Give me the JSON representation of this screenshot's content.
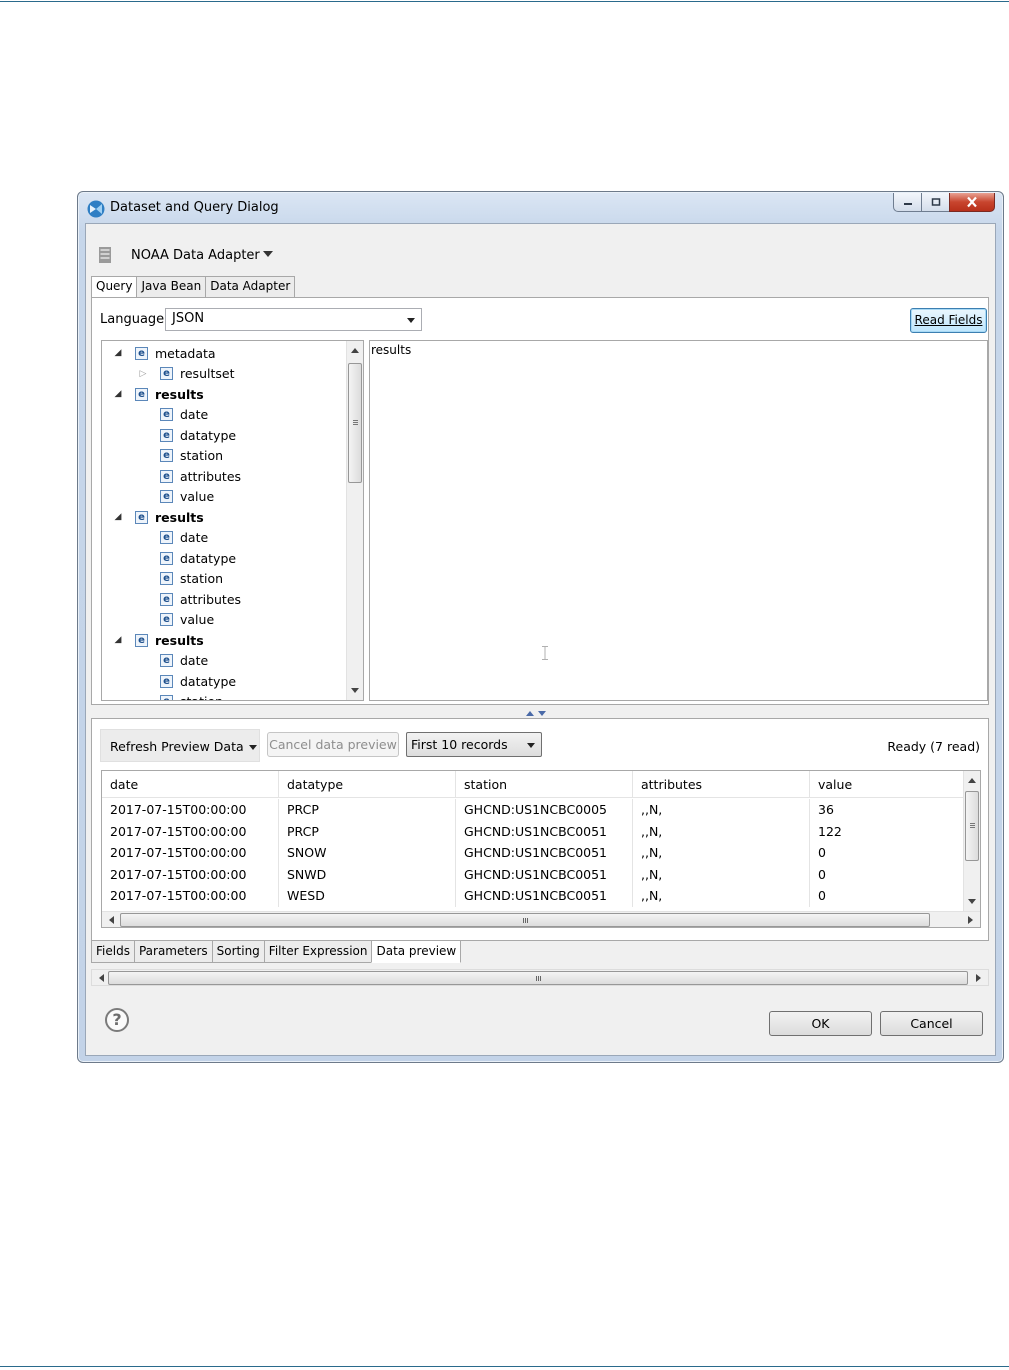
{
  "window": {
    "title": "Dataset and Query Dialog"
  },
  "adapter": {
    "name": "NOAA Data Adapter"
  },
  "top_tabs": [
    {
      "label": "Query",
      "active": true
    },
    {
      "label": "Java Bean",
      "active": false
    },
    {
      "label": "Data Adapter",
      "active": false
    }
  ],
  "query": {
    "language_label": "Language",
    "language_value": "JSON",
    "read_fields_label": "Read Fields",
    "text": "results"
  },
  "tree": [
    {
      "label": "metadata",
      "bold": false,
      "level": 0,
      "toggle": "expanded"
    },
    {
      "label": "resultset",
      "bold": false,
      "level": 1,
      "toggle": "collapsed"
    },
    {
      "label": "results",
      "bold": true,
      "level": 0,
      "toggle": "expanded"
    },
    {
      "label": "date",
      "bold": false,
      "level": 1,
      "toggle": "none"
    },
    {
      "label": "datatype",
      "bold": false,
      "level": 1,
      "toggle": "none"
    },
    {
      "label": "station",
      "bold": false,
      "level": 1,
      "toggle": "none"
    },
    {
      "label": "attributes",
      "bold": false,
      "level": 1,
      "toggle": "none"
    },
    {
      "label": "value",
      "bold": false,
      "level": 1,
      "toggle": "none"
    },
    {
      "label": "results",
      "bold": true,
      "level": 0,
      "toggle": "expanded"
    },
    {
      "label": "date",
      "bold": false,
      "level": 1,
      "toggle": "none"
    },
    {
      "label": "datatype",
      "bold": false,
      "level": 1,
      "toggle": "none"
    },
    {
      "label": "station",
      "bold": false,
      "level": 1,
      "toggle": "none"
    },
    {
      "label": "attributes",
      "bold": false,
      "level": 1,
      "toggle": "none"
    },
    {
      "label": "value",
      "bold": false,
      "level": 1,
      "toggle": "none"
    },
    {
      "label": "results",
      "bold": true,
      "level": 0,
      "toggle": "expanded"
    },
    {
      "label": "date",
      "bold": false,
      "level": 1,
      "toggle": "none"
    },
    {
      "label": "datatype",
      "bold": false,
      "level": 1,
      "toggle": "none"
    },
    {
      "label": "station",
      "bold": false,
      "level": 1,
      "toggle": "none"
    }
  ],
  "preview": {
    "refresh_label": "Refresh Preview Data",
    "cancel_label": "Cancel data preview",
    "records_value": "First 10 records",
    "status": "Ready (7 read)",
    "columns": [
      "date",
      "datatype",
      "station",
      "attributes",
      "value"
    ],
    "rows": [
      [
        "2017-07-15T00:00:00",
        "PRCP",
        "GHCND:US1NCBC0005",
        ",,N,",
        "36"
      ],
      [
        "2017-07-15T00:00:00",
        "PRCP",
        "GHCND:US1NCBC0051",
        ",,N,",
        "122"
      ],
      [
        "2017-07-15T00:00:00",
        "SNOW",
        "GHCND:US1NCBC0051",
        ",,N,",
        "0"
      ],
      [
        "2017-07-15T00:00:00",
        "SNWD",
        "GHCND:US1NCBC0051",
        ",,N,",
        "0"
      ],
      [
        "2017-07-15T00:00:00",
        "WESD",
        "GHCND:US1NCBC0051",
        ",,N,",
        "0"
      ]
    ]
  },
  "bottom_tabs": [
    {
      "label": "Fields",
      "active": false
    },
    {
      "label": "Parameters",
      "active": false
    },
    {
      "label": "Sorting",
      "active": false
    },
    {
      "label": "Filter Expression",
      "active": false
    },
    {
      "label": "Data preview",
      "active": true
    }
  ],
  "buttons": {
    "ok": "OK",
    "cancel": "Cancel"
  },
  "icons": {
    "app": "app-logo-icon",
    "adapter": "data-adapter-icon",
    "element": "element-icon",
    "help": "help-icon"
  },
  "colors": {
    "accent_border": "#3c7fb1",
    "close_button": "#c8452e",
    "element_icon": "#5b87b9"
  }
}
